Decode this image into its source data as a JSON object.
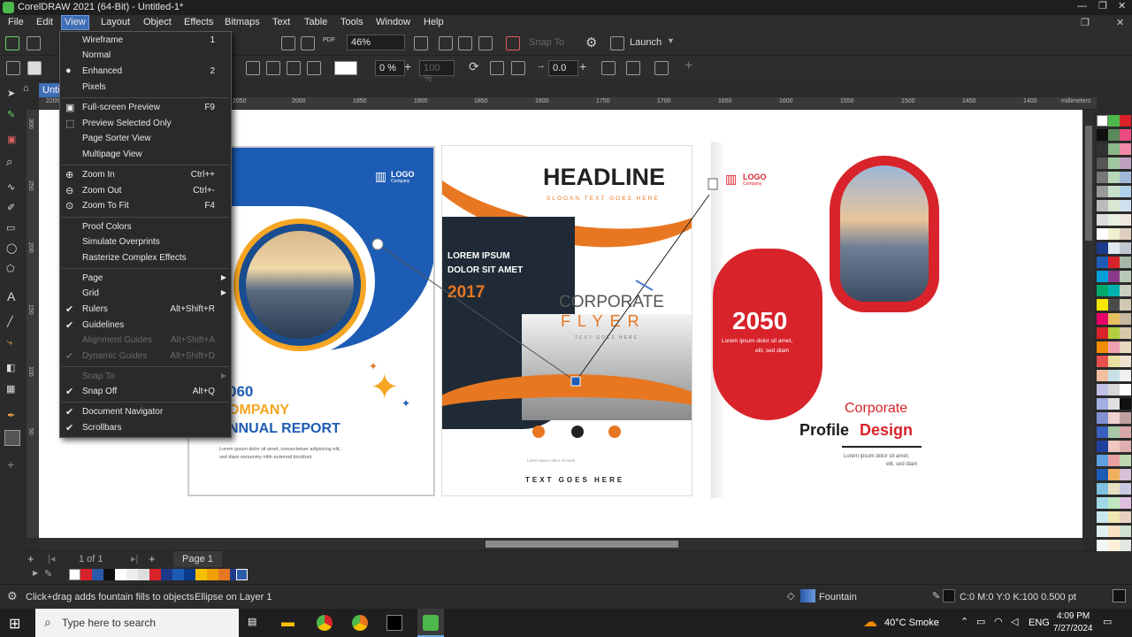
{
  "window": {
    "title": "CorelDRAW 2021 (64-Bit) - Untitled-1*"
  },
  "menubar": [
    "File",
    "Edit",
    "View",
    "Layout",
    "Object",
    "Effects",
    "Bitmaps",
    "Text",
    "Table",
    "Tools",
    "Window",
    "Help"
  ],
  "toolbar": {
    "zoom": "46%",
    "launch": "Launch",
    "snap_to": "Snap To",
    "percent": "0 %",
    "percent2": "100 %",
    "angle": "0.0"
  },
  "doc_tab": "Unti",
  "ruler": {
    "labels": [
      "2200",
      "2150",
      "2100",
      "2050",
      "2000",
      "1950",
      "1900",
      "1850",
      "1800",
      "1750",
      "1700",
      "1650",
      "1600",
      "1550",
      "1500",
      "1450",
      "1400"
    ],
    "unit": "millimeters",
    "vlabels": [
      "300",
      "250",
      "200",
      "150",
      "100",
      "50"
    ]
  },
  "view_menu": {
    "items": [
      {
        "label": "Wireframe",
        "shortcut": "1"
      },
      {
        "label": "Normal",
        "shortcut": ""
      },
      {
        "label": "Enhanced",
        "shortcut": "2",
        "bullet": true
      },
      {
        "label": "Pixels",
        "shortcut": ""
      },
      {
        "label": "Full-screen Preview",
        "shortcut": "F9"
      },
      {
        "label": "Preview Selected Only",
        "shortcut": ""
      },
      {
        "label": "Page Sorter View",
        "shortcut": ""
      },
      {
        "label": "Multipage View",
        "shortcut": ""
      },
      {
        "label": "Zoom In",
        "shortcut": "Ctrl++"
      },
      {
        "label": "Zoom Out",
        "shortcut": "Ctrl+-"
      },
      {
        "label": "Zoom To Fit",
        "shortcut": "F4"
      },
      {
        "label": "Proof Colors",
        "shortcut": ""
      },
      {
        "label": "Simulate Overprints",
        "shortcut": ""
      },
      {
        "label": "Rasterize Complex Effects",
        "shortcut": ""
      },
      {
        "label": "Page",
        "shortcut": ""
      },
      {
        "label": "Grid",
        "shortcut": ""
      },
      {
        "label": "Rulers",
        "shortcut": "Alt+Shift+R",
        "checked": true
      },
      {
        "label": "Guidelines",
        "shortcut": "",
        "checked": true
      },
      {
        "label": "Alignment Guides",
        "shortcut": "Alt+Shift+A",
        "disabled": true
      },
      {
        "label": "Dynamic Guides",
        "shortcut": "Alt+Shift+D",
        "disabled": true
      },
      {
        "label": "Snap To",
        "shortcut": "",
        "disabled": true
      },
      {
        "label": "Snap Off",
        "shortcut": "Alt+Q",
        "checked": true
      },
      {
        "label": "Document Navigator",
        "shortcut": "",
        "checked": true
      },
      {
        "label": "Scrollbars",
        "shortcut": "",
        "checked": true
      }
    ]
  },
  "canvas": {
    "page1": {
      "logo": "LOGO",
      "logo_sub": "Company",
      "year": "060",
      "company": "OMPANY",
      "report": "NNUAL REPORT",
      "body1": "Lorem ipsum dolor sit amet, consectetuer adipiscing elit,",
      "body2": "sed diam nonummy nibh euismod tincidunt"
    },
    "page2": {
      "headline": "HEADLINE",
      "slogan": "SLOGAN TEXT GOES HERE",
      "lorem1": "LOREM IPSUM",
      "lorem2": "DOLOR SIT AMET",
      "year": "2017",
      "corporate": "CORPORATE",
      "flyer": "FLYER",
      "text_goes_here": "TEXT GOES HERE",
      "footer": "TEXT GOES HERE",
      "small": "Lorem ipsum dolor sit amet"
    },
    "page3": {
      "logo": "LOGO",
      "logo_sub": "Company",
      "year": "2050",
      "lorem1": "Lorem ipsum dolor sit amet,",
      "lorem2": "elit, sed diam",
      "corporate": "Corporate",
      "profile": "Profile",
      "design": "Design",
      "foot1": "Lorem ipsum dolor sit amet,",
      "foot2": "elit, sed diam"
    }
  },
  "pagenav": {
    "count": "1 of 1",
    "page": "Page 1"
  },
  "status": {
    "hint": "Click+drag adds fountain fills to objects",
    "object": "Ellipse on Layer 1",
    "fill": "Fountain",
    "color": "C:0 M:0 Y:0 K:100  0.500 pt"
  },
  "taskbar": {
    "search": "Type here to search",
    "weather": "40°C  Smoke",
    "lang": "ENG",
    "time": "4:09 PM",
    "date": "7/27/2024"
  },
  "colors": {
    "accent": "#3f6fb6",
    "orange": "#e87722",
    "red": "#d8232a",
    "blue": "#1d5cb4"
  }
}
